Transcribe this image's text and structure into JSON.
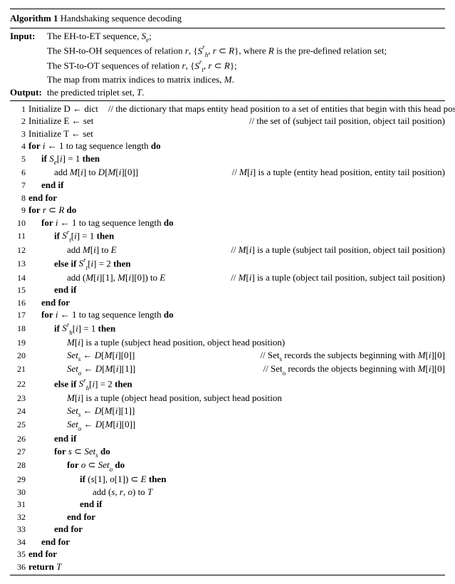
{
  "algorithm": {
    "number_label": "Algorithm 1",
    "title": "Handshaking sequence decoding"
  },
  "input": {
    "label": "Input:",
    "lines": [
      "The EH-to-ET sequence, S_e;",
      "The SH-to-OH sequences of relation r, {S_h^r, r ⊂ R}, where R is the pre-defined relation set;",
      "The ST-to-OT sequences of relation r, {S_t^r, r ⊂ R};",
      "The map from matrix indices to matrix indices, M."
    ]
  },
  "output": {
    "label": "Output:",
    "line": "the predicted triplet set, T."
  },
  "code": [
    {
      "n": "1",
      "indent": 0,
      "text": "Initialize D ← dict",
      "comment": "// the dictionary that maps entity head position to a set of entities that begin with this head position",
      "inline": true
    },
    {
      "n": "2",
      "indent": 0,
      "text": "Initialize E ← set",
      "comment": "// the set of (subject tail position, object tail position)"
    },
    {
      "n": "3",
      "indent": 0,
      "text": "Initialize T ← set",
      "comment": ""
    },
    {
      "n": "4",
      "indent": 0,
      "html": "<b>for</b> <i>i</i> ← 1 to tag sequence length <b>do</b>",
      "comment": ""
    },
    {
      "n": "5",
      "indent": 1,
      "html": "<b>if</b> <i>S<span class='sub'>e</span></i>[<i>i</i>] = 1 <b>then</b>",
      "comment": ""
    },
    {
      "n": "6",
      "indent": 2,
      "html": "add <i>M</i>[<i>i</i>] to <i>D</i>[<i>M</i>[<i>i</i>][0]]",
      "comment": "// M[i] is a tuple (entity head position, entity tail position)"
    },
    {
      "n": "7",
      "indent": 1,
      "html": "<b>end if</b>",
      "comment": ""
    },
    {
      "n": "8",
      "indent": 0,
      "html": "<b>end for</b>",
      "comment": ""
    },
    {
      "n": "9",
      "indent": 0,
      "html": "<b>for</b> <i>r</i> ⊂ <i>R</i> <b>do</b>",
      "comment": ""
    },
    {
      "n": "10",
      "indent": 1,
      "html": "<b>for</b> <i>i</i> ← 1 to tag sequence length <b>do</b>",
      "comment": ""
    },
    {
      "n": "11",
      "indent": 2,
      "html": "<b>if</b> <i>S<span class='sup'>r</span><span class='sub'>t</span></i>[<i>i</i>] = 1 <b>then</b>",
      "comment": ""
    },
    {
      "n": "12",
      "indent": 3,
      "html": "add <i>M</i>[<i>i</i>] to <i>E</i>",
      "comment": "// M[i] is a tuple (subject tail position, object tail position)"
    },
    {
      "n": "13",
      "indent": 2,
      "html": "<b>else if</b> <i>S<span class='sup'>r</span><span class='sub'>t</span></i>[<i>i</i>] = 2 <b>then</b>",
      "comment": ""
    },
    {
      "n": "14",
      "indent": 3,
      "html": "add (<i>M</i>[<i>i</i>][1], <i>M</i>[<i>i</i>][0]) to <i>E</i>",
      "comment": "// M[i] is a tuple (object tail position, subject tail position)"
    },
    {
      "n": "15",
      "indent": 2,
      "html": "<b>end if</b>",
      "comment": ""
    },
    {
      "n": "16",
      "indent": 1,
      "html": "<b>end for</b>",
      "comment": ""
    },
    {
      "n": "17",
      "indent": 1,
      "html": "<b>for</b> <i>i</i> ← 1 to tag sequence length <b>do</b>",
      "comment": ""
    },
    {
      "n": "18",
      "indent": 2,
      "html": "<b>if</b> <i>S<span class='sup'>r</span><span class='sub'>h</span></i>[<i>i</i>] = 1 <b>then</b>",
      "comment": ""
    },
    {
      "n": "19",
      "indent": 3,
      "html": "<i>M</i>[<i>i</i>] is a tuple (subject head position, object head position)",
      "comment": ""
    },
    {
      "n": "20",
      "indent": 3,
      "html": "<i>Set<span class='sub'>s</span></i> ← <i>D</i>[<i>M</i>[<i>i</i>][0]]",
      "comment": "// Set_s records the subjects beginning with M[i][0]"
    },
    {
      "n": "21",
      "indent": 3,
      "html": "<i>Set<span class='sub'>o</span></i> ← <i>D</i>[<i>M</i>[<i>i</i>][1]]",
      "comment": "// Set_o records the objects beginning with M[i][0]"
    },
    {
      "n": "22",
      "indent": 2,
      "html": "<b>else if</b> <i>S<span class='sup'>r</span><span class='sub'>h</span></i>[<i>i</i>] = 2 <b>then</b>",
      "comment": ""
    },
    {
      "n": "23",
      "indent": 3,
      "html": "<i>M</i>[<i>i</i>] is a tuple (object head position, subject head position",
      "comment": ""
    },
    {
      "n": "24",
      "indent": 3,
      "html": "<i>Set<span class='sub'>s</span></i> ← <i>D</i>[<i>M</i>[<i>i</i>][1]]",
      "comment": ""
    },
    {
      "n": "25",
      "indent": 3,
      "html": "<i>Set<span class='sub'>o</span></i> ← <i>D</i>[<i>M</i>[<i>i</i>][0]]",
      "comment": ""
    },
    {
      "n": "26",
      "indent": 2,
      "html": "<b>end if</b>",
      "comment": ""
    },
    {
      "n": "27",
      "indent": 2,
      "html": "<b>for</b> <i>s</i> ⊂ <i>Set<span class='sub'>s</span></i> <b>do</b>",
      "comment": ""
    },
    {
      "n": "28",
      "indent": 3,
      "html": "<b>for</b> <i>o</i> ⊂ <i>Set<span class='sub'>o</span></i> <b>do</b>",
      "comment": ""
    },
    {
      "n": "29",
      "indent": 4,
      "html": "<b>if</b> (<i>s</i>[1], <i>o</i>[1]) ⊂ <i>E</i> <b>then</b>",
      "comment": ""
    },
    {
      "n": "30",
      "indent": 5,
      "html": "add (<i>s</i>, <i>r</i>, <i>o</i>) to <i>T</i>",
      "comment": ""
    },
    {
      "n": "31",
      "indent": 4,
      "html": "<b>end if</b>",
      "comment": ""
    },
    {
      "n": "32",
      "indent": 3,
      "html": "<b>end for</b>",
      "comment": ""
    },
    {
      "n": "33",
      "indent": 2,
      "html": "<b>end for</b>",
      "comment": ""
    },
    {
      "n": "34",
      "indent": 1,
      "html": "<b>end for</b>",
      "comment": ""
    },
    {
      "n": "35",
      "indent": 0,
      "html": "<b>end for</b>",
      "comment": ""
    },
    {
      "n": "36",
      "indent": 0,
      "html": "<b>return</b> <i>T</i>",
      "comment": ""
    }
  ]
}
